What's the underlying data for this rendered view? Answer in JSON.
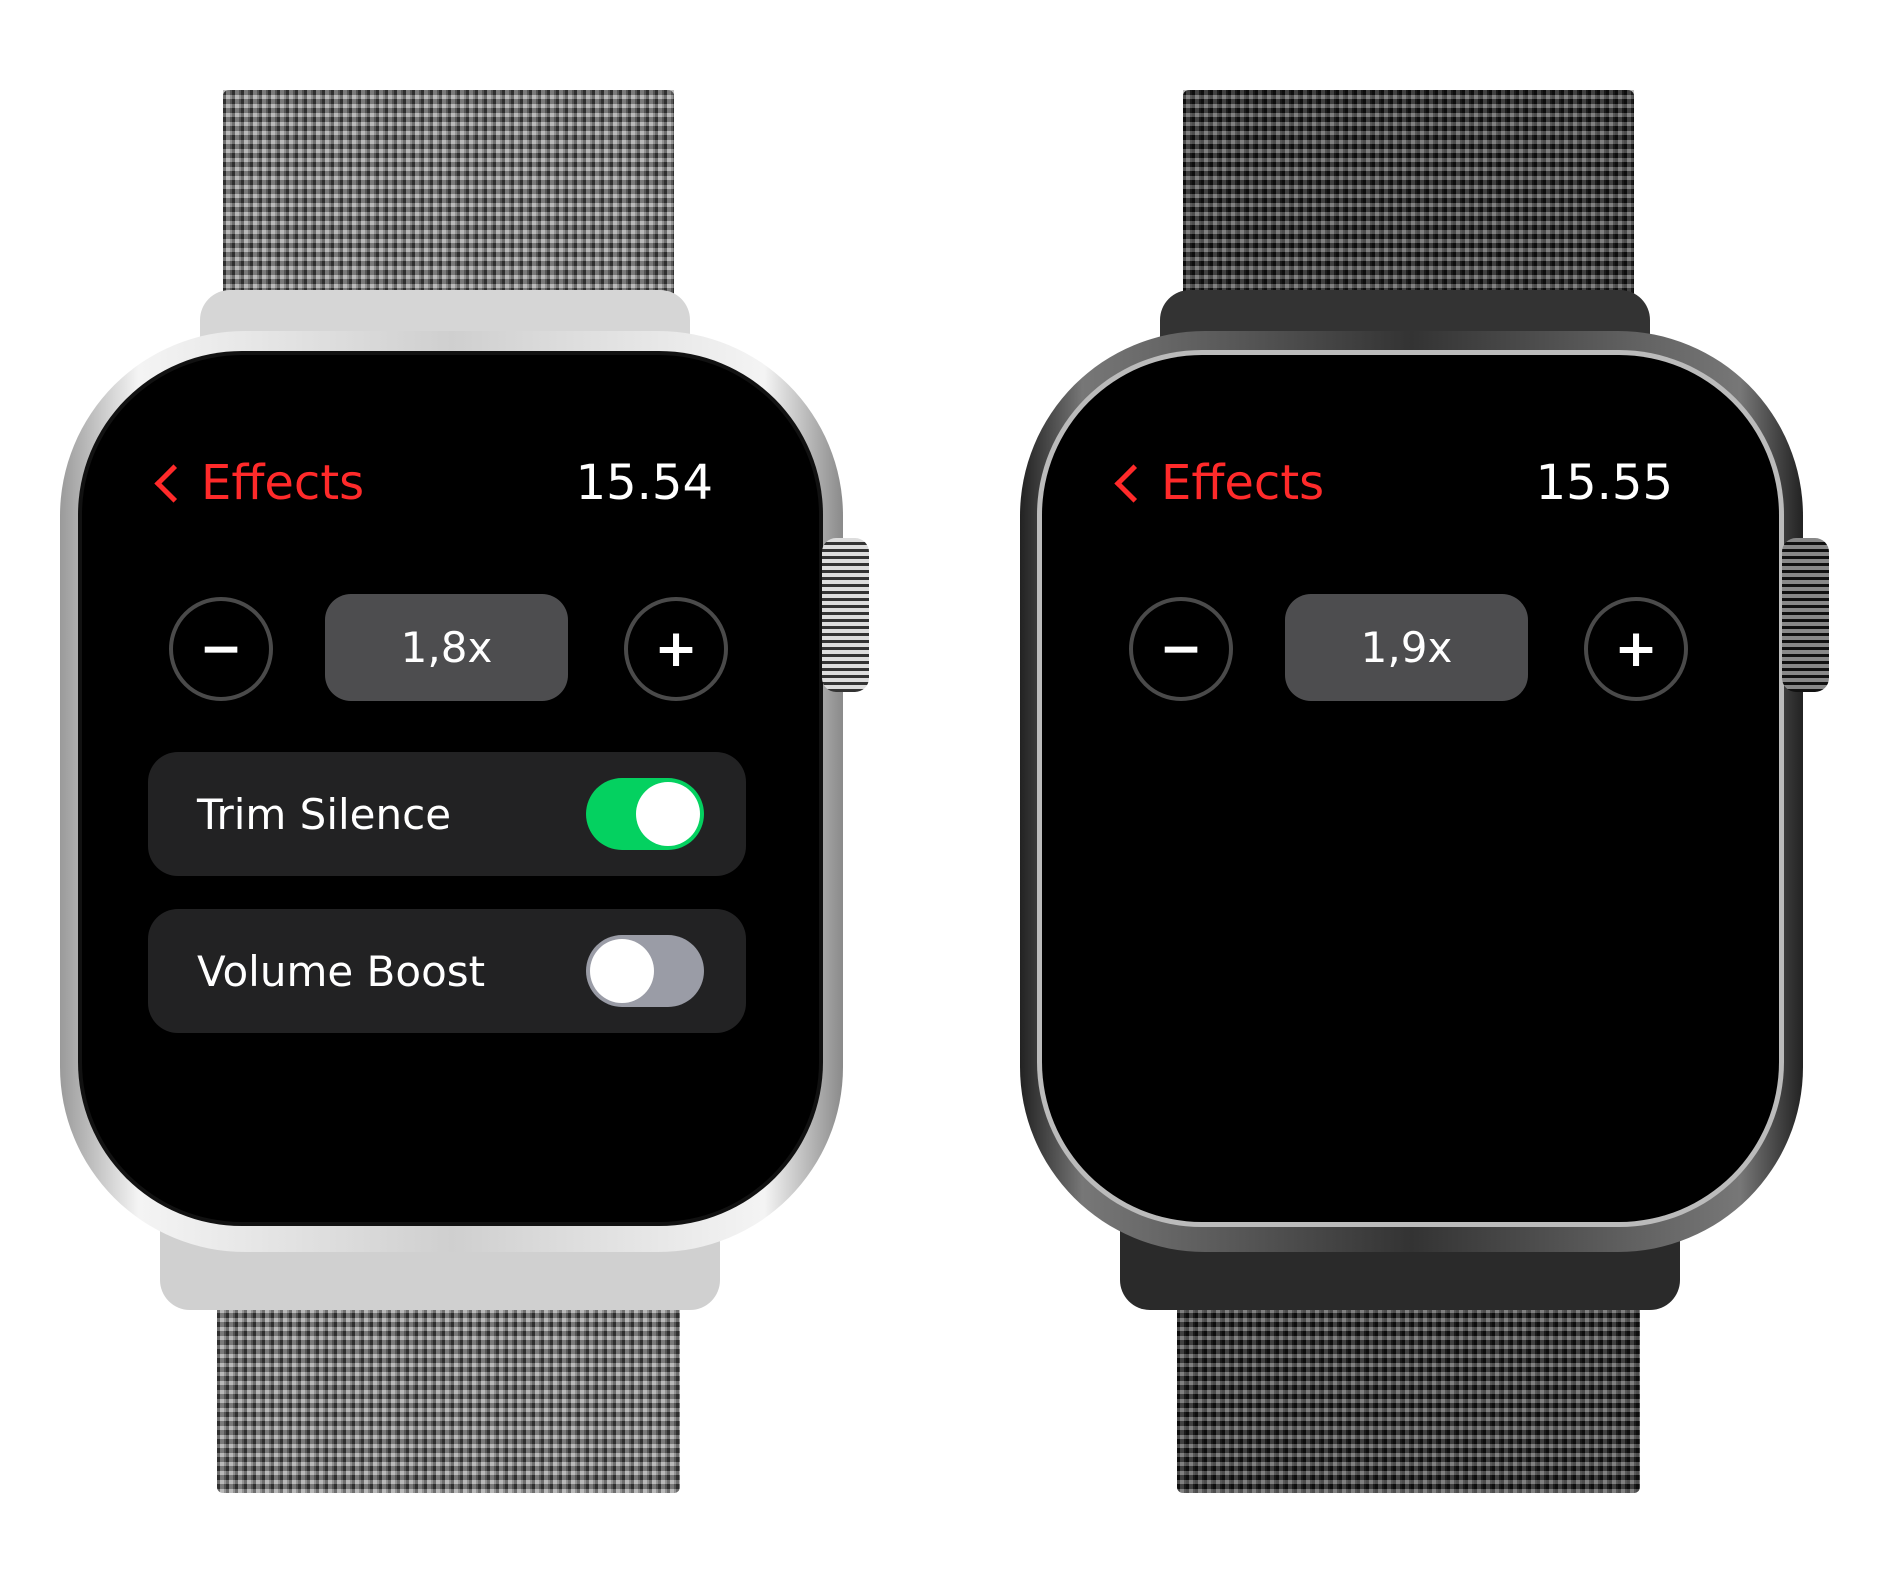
{
  "watches": [
    {
      "back_label": "Effects",
      "time": "15.54",
      "speed": "1,8x",
      "minus": "−",
      "plus": "+",
      "toggles": [
        {
          "label": "Trim Silence",
          "on": true
        },
        {
          "label": "Volume Boost",
          "on": false
        }
      ],
      "finish": "silver"
    },
    {
      "back_label": "Effects",
      "time": "15.55",
      "speed": "1,9x",
      "minus": "−",
      "plus": "+",
      "toggles": [],
      "finish": "space-black"
    }
  ],
  "colors": {
    "accent": "#ff2a2a",
    "toggle_on": "#04d160",
    "toggle_off": "#9a9ca6"
  }
}
